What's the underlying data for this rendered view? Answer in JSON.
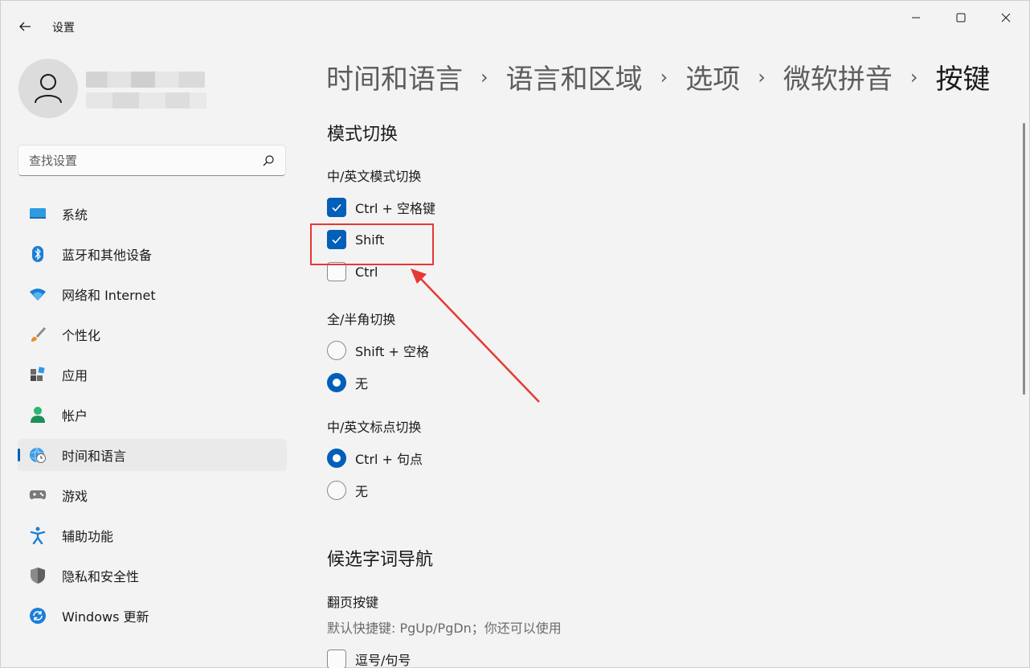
{
  "window": {
    "title": "设置",
    "controls": {
      "minimize": "minimize",
      "maximize": "maximize",
      "close": "close"
    }
  },
  "search": {
    "placeholder": "查找设置"
  },
  "sidebar": {
    "items": [
      {
        "label": "系统",
        "icon": "system-display-icon"
      },
      {
        "label": "蓝牙和其他设备",
        "icon": "bluetooth-icon"
      },
      {
        "label": "网络和 Internet",
        "icon": "wifi-icon"
      },
      {
        "label": "个性化",
        "icon": "brush-icon"
      },
      {
        "label": "应用",
        "icon": "apps-icon"
      },
      {
        "label": "帐户",
        "icon": "account-icon"
      },
      {
        "label": "时间和语言",
        "icon": "globe-clock-icon",
        "selected": true
      },
      {
        "label": "游戏",
        "icon": "gamepad-icon"
      },
      {
        "label": "辅助功能",
        "icon": "accessibility-icon"
      },
      {
        "label": "隐私和安全性",
        "icon": "shield-icon"
      },
      {
        "label": "Windows 更新",
        "icon": "update-icon"
      }
    ]
  },
  "breadcrumb": [
    "时间和语言",
    "语言和区域",
    "选项",
    "微软拼音",
    "按键"
  ],
  "main": {
    "mode_switch": {
      "title": "模式切换",
      "cn_en": {
        "label": "中/英文模式切换",
        "options": [
          {
            "label": "Ctrl + 空格键",
            "checked": true
          },
          {
            "label": "Shift",
            "checked": true
          },
          {
            "label": "Ctrl",
            "checked": false
          }
        ]
      },
      "full_half": {
        "label": "全/半角切换",
        "options": [
          {
            "label": "Shift + 空格",
            "selected": false
          },
          {
            "label": "无",
            "selected": true
          }
        ]
      },
      "punct": {
        "label": "中/英文标点切换",
        "options": [
          {
            "label": "Ctrl + 句点",
            "selected": true
          },
          {
            "label": "无",
            "selected": false
          }
        ]
      }
    },
    "candidate_nav": {
      "title": "候选字词导航",
      "page_keys": {
        "label": "翻页按键",
        "help": "默认快捷键: PgUp/PgDn；你还可以使用",
        "options": [
          {
            "label": "逗号/句号",
            "checked": false
          }
        ]
      }
    }
  },
  "colors": {
    "accent": "#005fb8",
    "annotation": "#e53935",
    "background": "#f3f3f3"
  }
}
